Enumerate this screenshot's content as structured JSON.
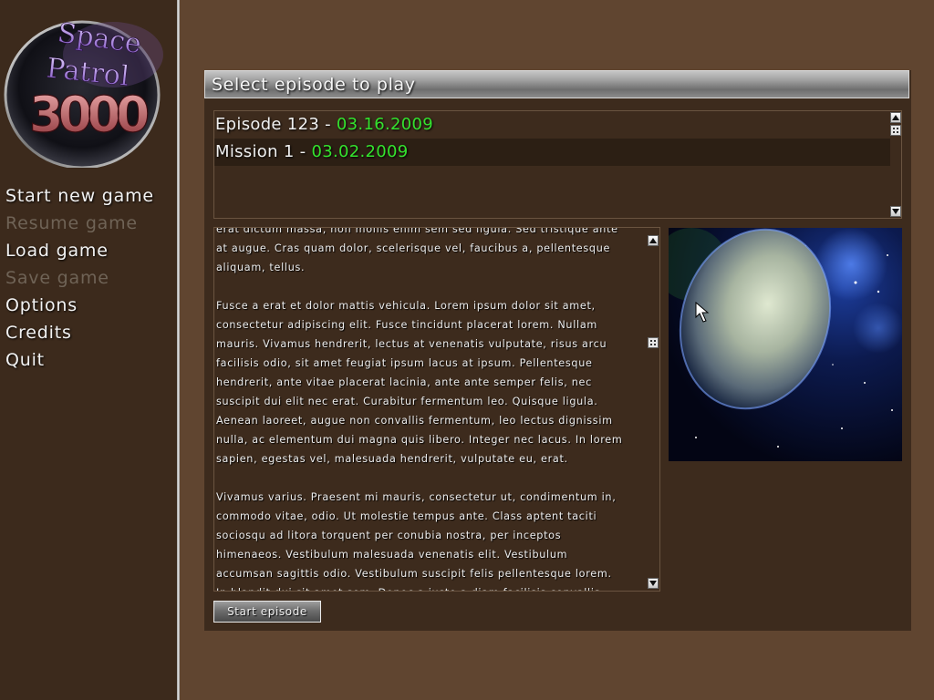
{
  "logo": {
    "text": "Space Patrol 3000"
  },
  "menu": {
    "start_new_game": "Start new game",
    "resume_game": "Resume game",
    "load_game": "Load game",
    "save_game": "Save game",
    "options": "Options",
    "credits": "Credits",
    "quit": "Quit"
  },
  "dialog": {
    "title": "Select episode to play",
    "episodes": [
      {
        "name": "Episode 123",
        "sep": " - ",
        "date": "03.16.2009"
      },
      {
        "name": "Mission 1",
        "sep": " - ",
        "date": "03.02.2009"
      }
    ],
    "selected_index": 1,
    "description": "erat dictum massa, non mollis enim sem sed ligula. Sed tristique ante\nat augue. Cras quam dolor, scelerisque vel, faucibus a, pellentesque\naliquam, tellus.\n\nFusce a erat et dolor mattis vehicula. Lorem ipsum dolor sit amet,\nconsectetur adipiscing elit. Fusce tincidunt placerat lorem. Nullam\nmauris. Vivamus hendrerit, lectus at venenatis vulputate, risus arcu\nfacilisis odio, sit amet feugiat ipsum lacus at ipsum. Pellentesque\nhendrerit, ante vitae placerat lacinia, ante ante semper felis, nec\nsuscipit dui elit nec erat. Curabitur fermentum leo. Quisque ligula.\nAenean laoreet, augue non convallis fermentum, leo lectus dignissim\nnulla, ac elementum dui magna quis libero. Integer nec lacus. In lorem\nsapien, egestas vel, malesuada hendrerit, vulputate eu, erat.\n\nVivamus varius. Praesent mi mauris, consectetur ut, condimentum in,\ncommodo vitae, odio. Ut molestie tempus ante. Class aptent taciti\nsociosqu ad litora torquent per conubia nostra, per inceptos\nhimenaeos. Vestibulum malesuada venenatis elit. Vestibulum\naccumsan sagittis odio. Vestibulum suscipit felis pellentesque lorem.\nIn blandit dui sit amet sem. Donec a justo a diam facilisis convallis.",
    "start_button": "Start episode"
  },
  "colors": {
    "background": "#604530",
    "sidebar": "#3c2a1c",
    "panel": "#3d2b1d",
    "date_green": "#34e22e",
    "disabled_text": "#6f6356"
  },
  "icons": [
    "scroll-up-icon",
    "scroll-down-icon",
    "scroll-thumb-icon",
    "planet-image",
    "mouse-cursor-icon"
  ]
}
